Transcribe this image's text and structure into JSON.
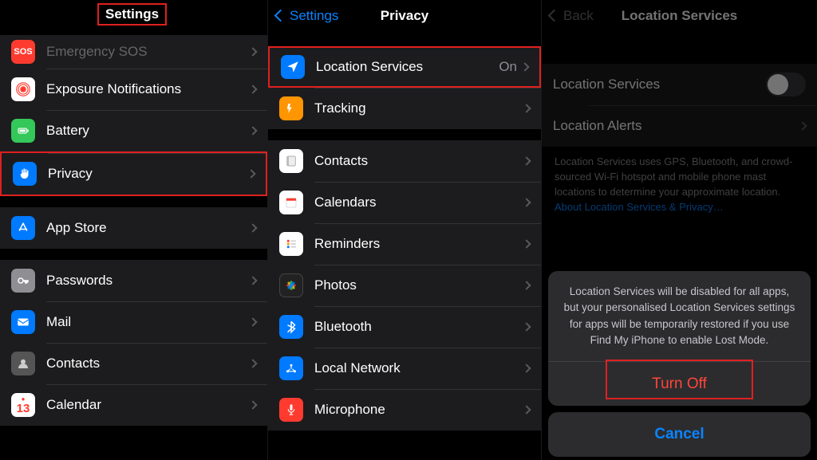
{
  "pane1": {
    "title": "Settings",
    "groups": [
      [
        {
          "icon": "sos",
          "label": "Emergency SOS"
        },
        {
          "icon": "exposure",
          "label": "Exposure Notifications"
        },
        {
          "icon": "battery",
          "label": "Battery"
        },
        {
          "icon": "privacy",
          "label": "Privacy",
          "highlight": true
        }
      ],
      [
        {
          "icon": "appstore",
          "label": "App Store"
        }
      ],
      [
        {
          "icon": "passwords",
          "label": "Passwords"
        },
        {
          "icon": "mail",
          "label": "Mail"
        },
        {
          "icon": "contacts",
          "label": "Contacts"
        },
        {
          "icon": "calendar",
          "label": "Calendar"
        }
      ]
    ]
  },
  "pane2": {
    "back": "Settings",
    "title": "Privacy",
    "groups": [
      [
        {
          "icon": "location",
          "label": "Location Services",
          "status": "On",
          "highlight": true
        },
        {
          "icon": "tracking",
          "label": "Tracking"
        }
      ],
      [
        {
          "icon": "contacts2",
          "label": "Contacts"
        },
        {
          "icon": "calendars",
          "label": "Calendars"
        },
        {
          "icon": "reminders",
          "label": "Reminders"
        },
        {
          "icon": "photos",
          "label": "Photos"
        },
        {
          "icon": "bluetooth",
          "label": "Bluetooth"
        },
        {
          "icon": "network",
          "label": "Local Network"
        },
        {
          "icon": "microphone",
          "label": "Microphone"
        }
      ]
    ]
  },
  "pane3": {
    "back": "Back",
    "title": "Location Services",
    "rows": {
      "locServices": "Location Services",
      "locAlerts": "Location Alerts"
    },
    "desc_prefix": "Location Services uses GPS, Bluetooth, and crowd-sourced Wi-Fi hotspot and mobile phone mast locations to determine your approximate location. ",
    "desc_link": "About Location Services & Privacy…",
    "sheet": {
      "message": "Location Services will be disabled for all apps, but your personalised Location Services settings for apps will be temporarily restored if you use Find My iPhone to enable Lost Mode.",
      "turn_off": "Turn Off",
      "cancel": "Cancel"
    }
  }
}
